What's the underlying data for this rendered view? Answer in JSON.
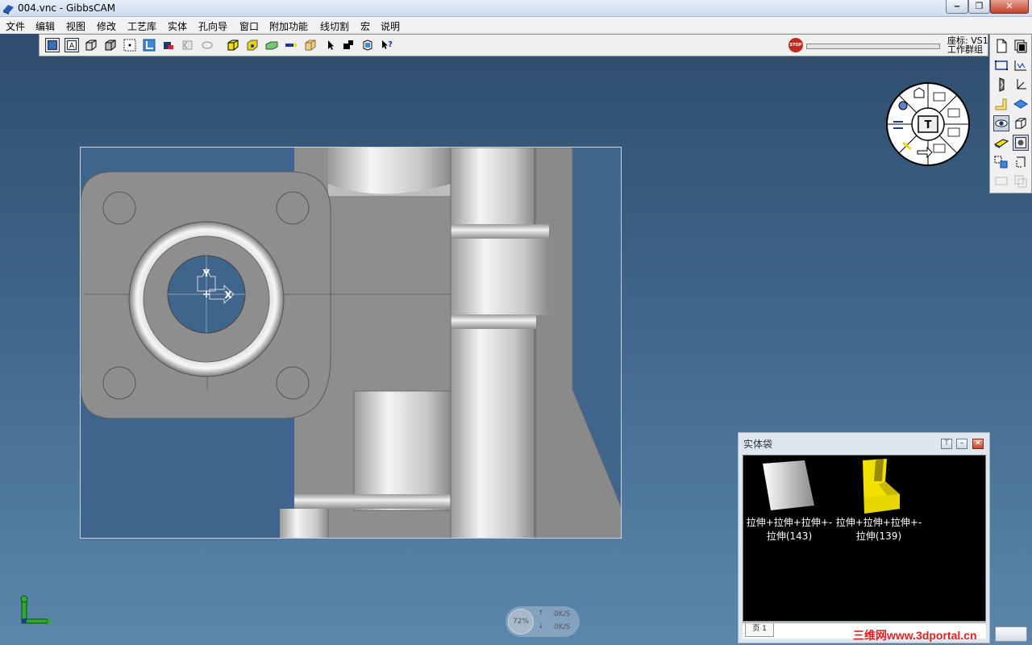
{
  "window": {
    "title": "004.vnc - GibbsCAM"
  },
  "menu": {
    "items": [
      "文件",
      "编辑",
      "视图",
      "修改",
      "工艺库",
      "实体",
      "孔向导",
      "窗口",
      "附加功能",
      "线切割",
      "宏",
      "说明"
    ]
  },
  "toolbar": {
    "coord_line1": "座标: VS1",
    "coord_line2": "工作群组"
  },
  "viewport": {
    "axis_y": "Y",
    "axis_x": "X"
  },
  "dial": {
    "center_label": "T"
  },
  "solid_bag": {
    "title": "实体袋",
    "items": [
      {
        "line1": "拉伸+拉伸+拉伸+-",
        "line2": "拉伸(143)"
      },
      {
        "line1": "拉伸+拉伸+拉伸+-",
        "line2": "拉伸(139)"
      }
    ],
    "tab": "页 1"
  },
  "net_widget": {
    "percent": "72%",
    "up": "0K/S",
    "down": "0K/S"
  },
  "watermark": "三维网www.3dportal.cn",
  "colors": {
    "background_top": "#2d4a6a",
    "background_bottom": "#5c86ac",
    "part_gray": "#8e8e8e",
    "solid_yellow": "#f2e000"
  }
}
